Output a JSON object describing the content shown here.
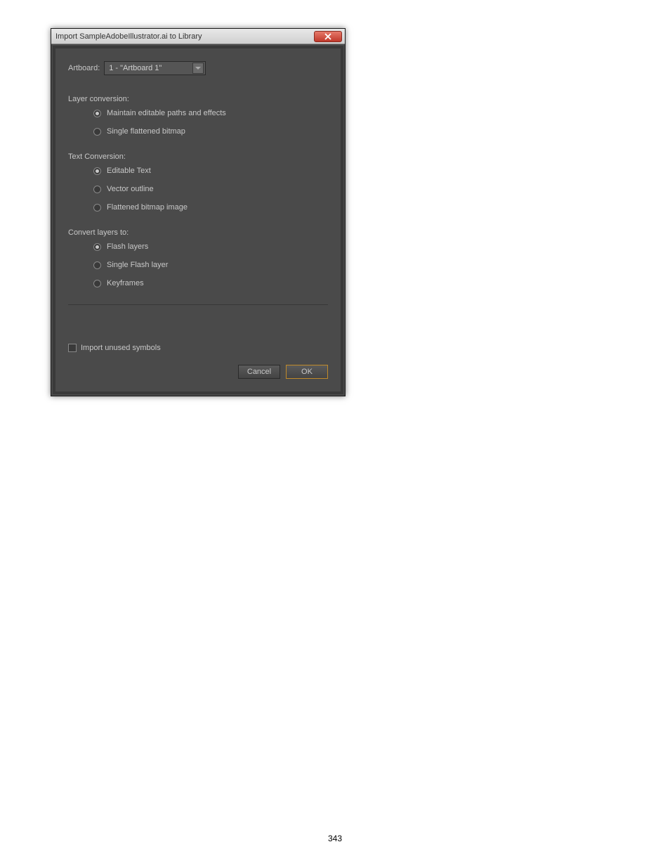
{
  "dialog": {
    "title": "Import SampleAdobeIllustrator.ai to Library",
    "artboard": {
      "label": "Artboard:",
      "value": "1 - \"Artboard 1\""
    },
    "layerConversion": {
      "title": "Layer conversion:",
      "options": [
        {
          "label": "Maintain editable paths and effects",
          "checked": true
        },
        {
          "label": "Single flattened bitmap",
          "checked": false
        }
      ]
    },
    "textConversion": {
      "title": "Text Conversion:",
      "options": [
        {
          "label": "Editable Text",
          "checked": true
        },
        {
          "label": "Vector outline",
          "checked": false
        },
        {
          "label": "Flattened bitmap image",
          "checked": false
        }
      ]
    },
    "convertLayers": {
      "title": "Convert layers to:",
      "options": [
        {
          "label": "Flash layers",
          "checked": true
        },
        {
          "label": "Single Flash layer",
          "checked": false
        },
        {
          "label": "Keyframes",
          "checked": false
        }
      ]
    },
    "importUnused": {
      "label": "Import unused symbols",
      "checked": false
    },
    "buttons": {
      "cancel": "Cancel",
      "ok": "OK"
    }
  },
  "pageNumber": "343"
}
